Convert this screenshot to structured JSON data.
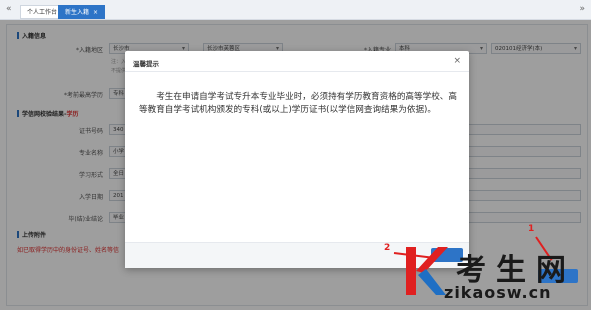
{
  "tabs": {
    "nav_left": "«",
    "nav_right": "»",
    "items": [
      {
        "label": "个人工作台"
      },
      {
        "label": "新生入籍",
        "close": "×"
      }
    ]
  },
  "section1": {
    "title": "入籍信息"
  },
  "form": {
    "area_label": "*入籍地区",
    "area_value": "长沙市",
    "district_value": "长沙市芙蓉区",
    "major_label": "*入籍专业",
    "level_value": "本科",
    "major_value": "020101经济学(本)",
    "note1": "注：入",
    "note2": "不提供",
    "prior_label": "*考前最高学历",
    "prior_value": "专科"
  },
  "section2": {
    "title": "学信网校验结果-",
    "highlight": "学历"
  },
  "verify": {
    "cert_label": "证书号码",
    "cert_value": "340",
    "major_label": "专业名称",
    "major_value": "小学",
    "study_label": "学习形式",
    "study_value": "全日",
    "enroll_label": "入学日期",
    "enroll_value": "201",
    "grad_label": "毕(结)业结论",
    "grad_value": "毕业"
  },
  "section3": {
    "title": "上传附件"
  },
  "upload_tip": "如已取得学历中的身份证号、姓名等信",
  "dialog": {
    "title": "温馨提示",
    "close": "×",
    "body": "考生在申请自学考试专升本专业毕业时，必须持有学历教育资格的高等学校、高等教育自学考试机构颁发的专科(或以上)学历证书(以学信网查询结果为依据)。"
  },
  "annotations": {
    "one": "1",
    "two": "2"
  },
  "watermark": {
    "brand": "考生网",
    "url": "zikaosw.cn"
  },
  "colors": {
    "primary": "#2d74c7",
    "annotation": "#e02020"
  }
}
